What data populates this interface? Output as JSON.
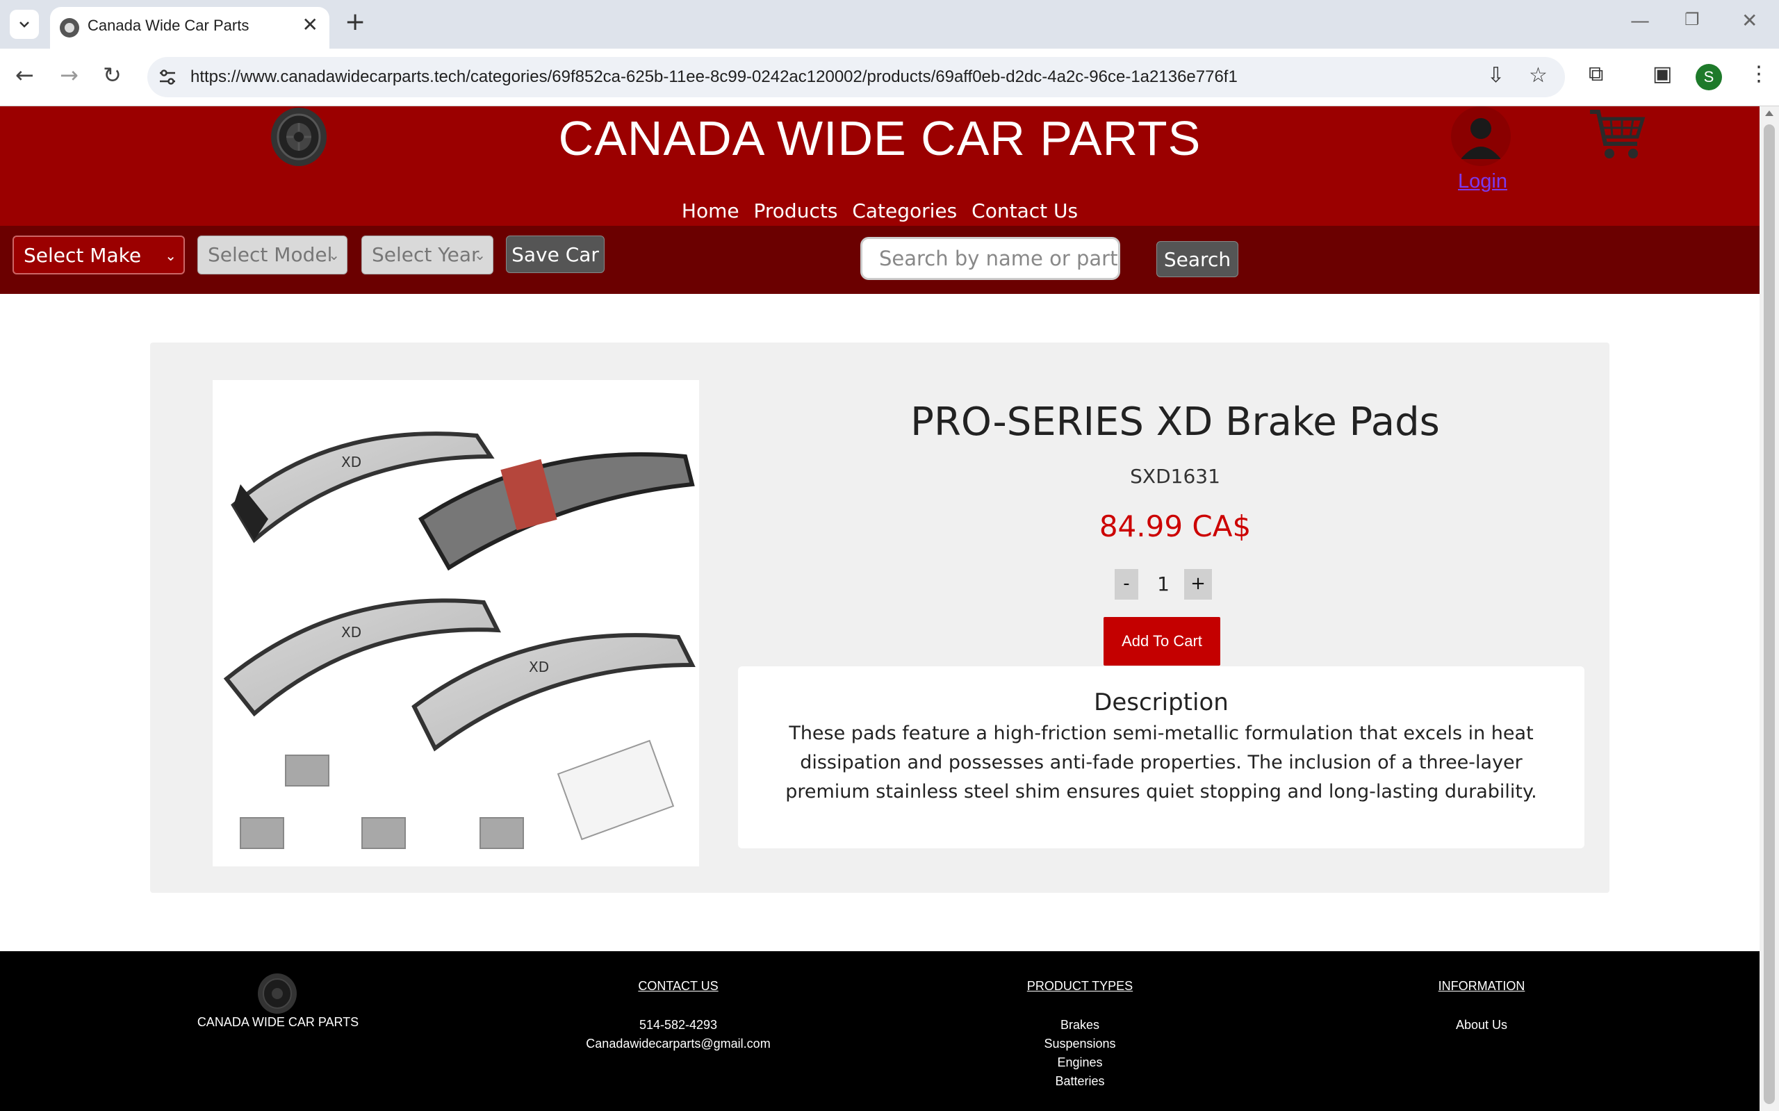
{
  "browser": {
    "tab_title": "Canada Wide Car Parts",
    "url": "https://www.canadawidecarparts.tech/categories/69f852ca-625b-11ee-8c99-0242ac120002/products/69aff0eb-d2dc-4a2c-96ce-1a2136e776f1",
    "profile_initial": "S"
  },
  "header": {
    "site_title": "CANADA WIDE CAR PARTS",
    "login_label": "Login",
    "nav": [
      "Home",
      "Products",
      "Categories",
      "Contact Us"
    ]
  },
  "filters": {
    "make_placeholder": "Select Make",
    "model_placeholder": "Select Model",
    "year_placeholder": "Select Year",
    "save_car_label": "Save Car",
    "search_placeholder": "Search by name or part number",
    "search_label": "Search"
  },
  "product": {
    "name": "PRO-SERIES XD Brake Pads",
    "sku": "SXD1631",
    "price": "84.99 CA$",
    "quantity": "1",
    "qty_minus": "-",
    "qty_plus": "+",
    "add_to_cart_label": "Add To Cart",
    "description_title": "Description",
    "description": "These pads feature a high-friction semi-metallic formulation that excels in heat dissipation and possesses anti-fade properties. The inclusion of a three-layer premium stainless steel shim ensures quiet stopping and long-lasting durability.",
    "image_marking": "XD"
  },
  "footer": {
    "brand": "CANADA WIDE CAR PARTS",
    "contact": {
      "heading": "CONTACT US",
      "phone": "514-582-4293",
      "email": "Canadawidecarparts@gmail.com"
    },
    "product_types": {
      "heading": "PRODUCT TYPES",
      "items": [
        "Brakes",
        "Suspensions",
        "Engines",
        "Batteries"
      ]
    },
    "information": {
      "heading": "INFORMATION",
      "items": [
        "About Us"
      ]
    }
  },
  "colors": {
    "header_red": "#9b0000",
    "filter_bar": "#6b0000",
    "price_red": "#cc0000",
    "add_to_cart": "#c40000"
  }
}
